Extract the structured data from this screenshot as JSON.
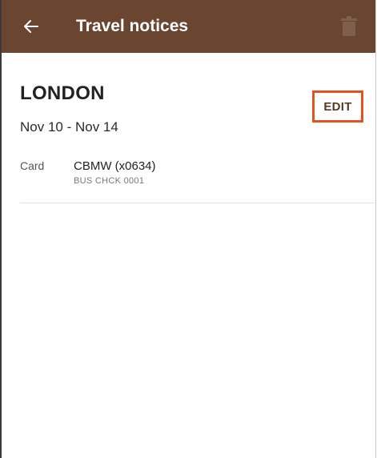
{
  "appbar": {
    "title": "Travel notices",
    "back_icon": "arrow-left-icon",
    "delete_icon": "trash-icon",
    "background_color": "#6a4530"
  },
  "notice": {
    "city": "LONDON",
    "dates": "Nov 10 - Nov 14",
    "edit_label": "EDIT",
    "card_label": "Card",
    "card_name": "CBMW (x0634)",
    "card_account": "BUS CHCK 0001"
  },
  "colors": {
    "accent_highlight": "#e2531f"
  }
}
